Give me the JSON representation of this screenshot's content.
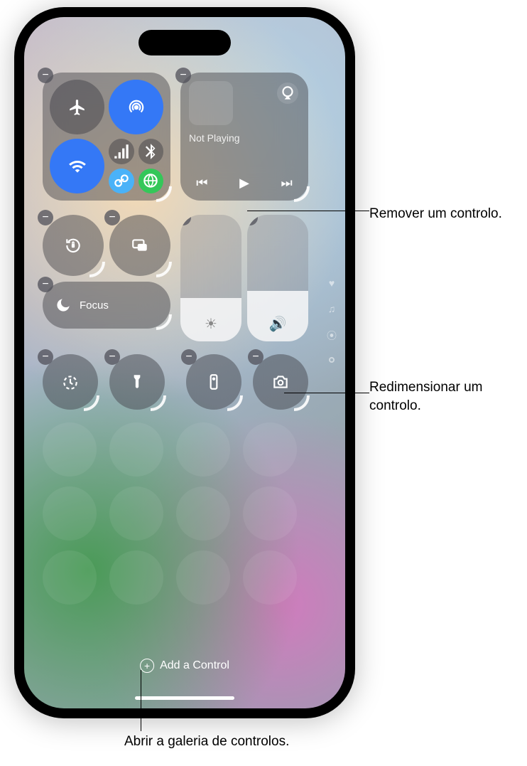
{
  "media": {
    "status": "Not Playing"
  },
  "focus": {
    "label": "Focus"
  },
  "add_control": {
    "label": "Add a Control"
  },
  "callouts": {
    "remove": "Remover um controlo.",
    "resize": "Redimensionar um controlo.",
    "open_gallery": "Abrir a galeria de controlos."
  },
  "icons": {
    "airplane": "airplane-icon",
    "airdrop": "airdrop-icon",
    "wifi": "wifi-icon",
    "cellular": "cellular-icon",
    "bluetooth": "bluetooth-icon",
    "personal_hotspot": "personal-hotspot-icon",
    "satellite": "satellite-icon",
    "airplay": "airplay-icon",
    "orientation_lock": "orientation-lock-icon",
    "screen_mirroring": "screen-mirroring-icon",
    "moon": "moon-icon",
    "sun": "sun-icon",
    "speaker": "speaker-icon",
    "timer": "timer-icon",
    "flashlight": "flashlight-icon",
    "remote": "apple-tv-remote-icon",
    "camera": "camera-icon",
    "heart": "heart-icon",
    "music_note": "music-note-icon",
    "broadcast": "broadcast-icon",
    "remove": "remove-icon",
    "resize": "resize-handle-icon",
    "plus": "plus-icon",
    "rewind": "rewind-icon",
    "play": "play-icon",
    "fastforward": "fast-forward-icon"
  }
}
